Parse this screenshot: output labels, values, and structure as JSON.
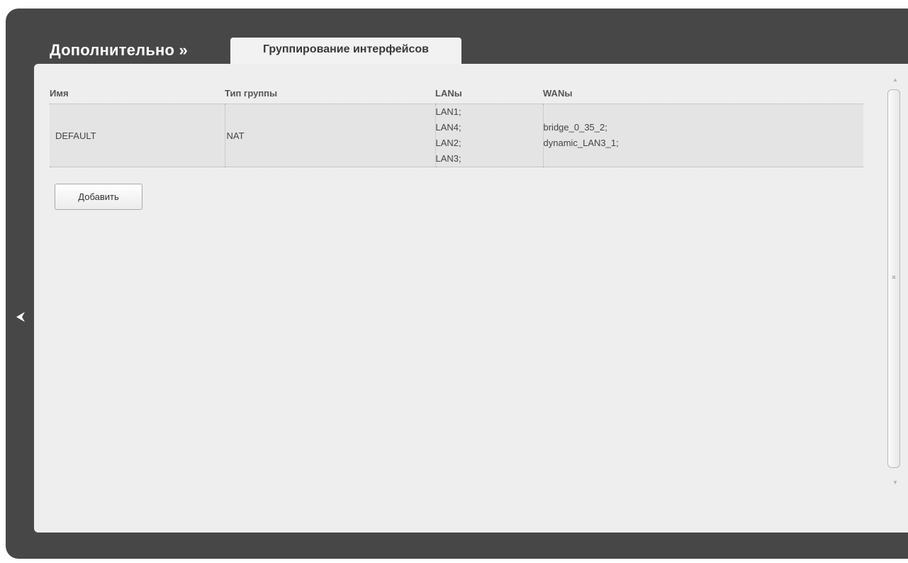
{
  "header": {
    "title": "Дополнительно »",
    "active_tab": "Группирование интерфейсов"
  },
  "table": {
    "columns": [
      "Имя",
      "Тип группы",
      "LANы",
      "WANы"
    ],
    "rows": [
      {
        "name": "DEFAULT",
        "type": "NAT",
        "lans": [
          "LAN1;",
          "LAN4;",
          "LAN2;",
          "LAN3;"
        ],
        "wans": [
          "bridge_0_35_2;",
          "dynamic_LAN3_1;"
        ]
      }
    ]
  },
  "actions": {
    "add_label": "Добавить"
  },
  "icons": {
    "back": "back-arrow-icon",
    "scroll_up": "scroll-up-icon",
    "scroll_down": "scroll-down-icon",
    "grip": "grip-icon"
  },
  "colors": {
    "frame": "#474747",
    "content": "#eeeeee",
    "row_bg": "#e4e4e4"
  }
}
